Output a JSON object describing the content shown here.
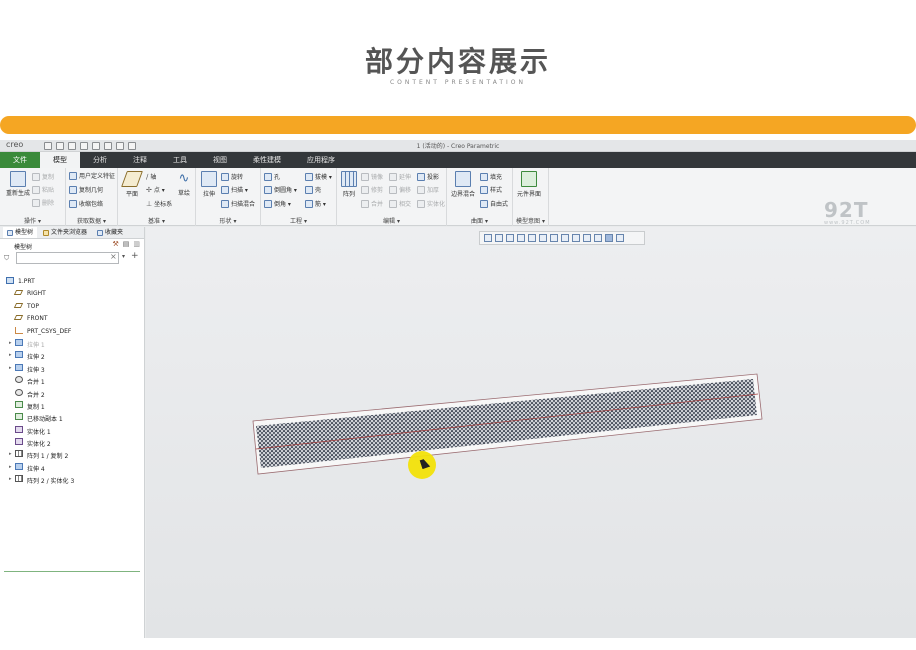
{
  "banner": {
    "title": "部分内容展示",
    "subtitle": "CONTENT PRESENTATION"
  },
  "window": {
    "logo": "creo",
    "title": "1 (活动的) - Creo Parametric"
  },
  "menu": {
    "tabs": [
      "文件",
      "模型",
      "分析",
      "注释",
      "工具",
      "视图",
      "柔性建模",
      "应用程序"
    ],
    "active_index": 1
  },
  "ribbon": {
    "operations": {
      "label": "操作 ▾",
      "regen": "重新生成",
      "copy": "复制",
      "paste": "粘贴",
      "delete": "删除"
    },
    "get_data": {
      "label": "获取数据 ▾",
      "udf": "用户定义特征",
      "copy_geom": "复制几何",
      "shrinkwrap": "收缩包络"
    },
    "datum": {
      "label": "基准 ▾",
      "plane": "平面",
      "axis": "轴",
      "point": "点 ▾",
      "csys": "坐标系",
      "curve": "草绘"
    },
    "shapes": {
      "label": "形状 ▾",
      "extrude": "拉伸",
      "revolve": "旋转",
      "sweep": "扫描 ▾",
      "swept_blend": "扫描混合"
    },
    "engineering": {
      "label": "工程 ▾",
      "hole": "孔",
      "round": "倒圆角 ▾",
      "chamfer": "倒角 ▾",
      "draft": "拔模 ▾",
      "shell": "壳",
      "rib": "筋 ▾"
    },
    "editing": {
      "label": "编辑 ▾",
      "pattern": "阵列",
      "mirror": "镜像",
      "extend": "延伸",
      "project": "投影",
      "trim": "修剪",
      "offset": "偏移",
      "thicken": "加厚",
      "merge": "合并",
      "intersect": "相交",
      "solidify": "实体化"
    },
    "surfaces": {
      "label": "曲面 ▾",
      "boundary": "边界混合",
      "fill": "填充",
      "style": "样式",
      "freestyle": "自由式"
    },
    "model_intent": {
      "label": "模型意图 ▾",
      "component_interface": "元件界面"
    }
  },
  "watermark": {
    "text": "92T",
    "url_text": "www.92T.COM"
  },
  "panel": {
    "tabs": [
      "模型树",
      "文件夹浏览器",
      "收藏夹"
    ],
    "tree_label": "模型树",
    "search_value": "",
    "items": [
      {
        "label": "1.PRT",
        "icon": "part",
        "arrow": "",
        "indent": 0,
        "dim": false
      },
      {
        "label": "RIGHT",
        "icon": "plane",
        "arrow": "",
        "indent": 1,
        "dim": false
      },
      {
        "label": "TOP",
        "icon": "plane",
        "arrow": "",
        "indent": 1,
        "dim": false
      },
      {
        "label": "FRONT",
        "icon": "plane",
        "arrow": "",
        "indent": 1,
        "dim": false
      },
      {
        "label": "PRT_CSYS_DEF",
        "icon": "csys",
        "arrow": "",
        "indent": 1,
        "dim": false
      },
      {
        "label": "拉伸 1",
        "icon": "feat",
        "arrow": "▸",
        "indent": 1,
        "dim": true
      },
      {
        "label": "拉伸 2",
        "icon": "feat",
        "arrow": "▸",
        "indent": 1,
        "dim": false
      },
      {
        "label": "拉伸 3",
        "icon": "feat",
        "arrow": "▸",
        "indent": 1,
        "dim": false
      },
      {
        "label": "合并 1",
        "icon": "merge",
        "arrow": "",
        "indent": 1,
        "dim": false
      },
      {
        "label": "合并 2",
        "icon": "merge",
        "arrow": "",
        "indent": 1,
        "dim": false
      },
      {
        "label": "复制 1",
        "icon": "copy",
        "arrow": "",
        "indent": 1,
        "dim": false
      },
      {
        "label": "已移动副本 1",
        "icon": "copy",
        "arrow": "",
        "indent": 1,
        "dim": false
      },
      {
        "label": "实体化 1",
        "icon": "solid",
        "arrow": "",
        "indent": 1,
        "dim": false
      },
      {
        "label": "实体化 2",
        "icon": "solid",
        "arrow": "",
        "indent": 1,
        "dim": false
      },
      {
        "label": "阵列 1 / 复制 2",
        "icon": "pattern",
        "arrow": "▸",
        "indent": 1,
        "dim": false
      },
      {
        "label": "拉伸 4",
        "icon": "feat",
        "arrow": "▸",
        "indent": 1,
        "dim": false
      },
      {
        "label": "阵列 2 / 实体化 3",
        "icon": "pattern",
        "arrow": "▸",
        "indent": 1,
        "dim": false
      }
    ]
  },
  "colors": {
    "banner_bar": "#f5a623",
    "menubar": "#33373a",
    "file_tab": "#3a8a3a",
    "highlight": "#f2e10a"
  }
}
